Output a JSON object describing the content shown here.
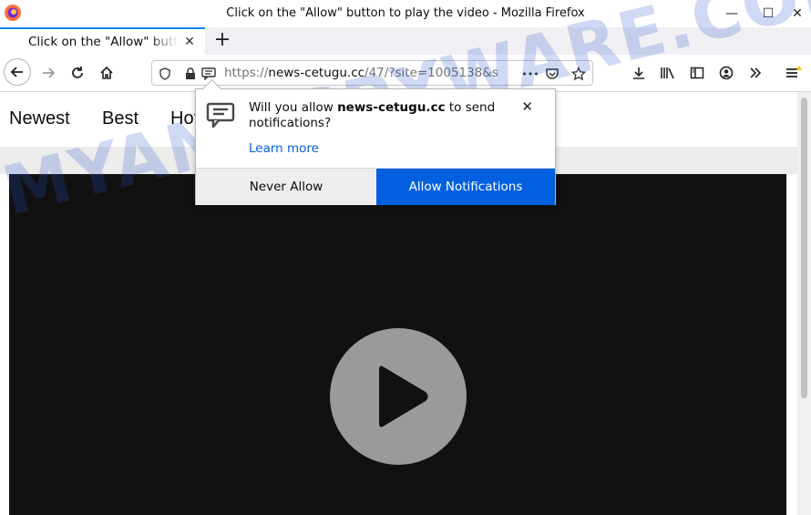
{
  "window": {
    "title": "Click on the \"Allow\" button to play the video - Mozilla Firefox",
    "minimize_glyph": "—",
    "maximize_glyph": "☐",
    "close_glyph": "✕"
  },
  "tab": {
    "label": "Click on the \"Allow\" button to play the video",
    "close_glyph": "✕",
    "new_tab_glyph": "+"
  },
  "urlbar": {
    "scheme": "https://",
    "host": "news-cetugu.cc",
    "path": "/47/?site=1005138&s",
    "more_glyph": "•••"
  },
  "site_nav": {
    "items": [
      "Newest",
      "Best",
      "Hot"
    ]
  },
  "popup": {
    "message_prefix": "Will you allow ",
    "site": "news-cetugu.cc",
    "message_suffix": " to send notifications?",
    "learn_more": "Learn more",
    "close_glyph": "✕",
    "never_allow": "Never Allow",
    "allow": "Allow Notifications"
  },
  "watermark": "MYANTISPYWARE.COM",
  "colors": {
    "accent": "#0060df",
    "tab_indicator": "#0a84ff",
    "video_bg": "#111111",
    "play_button": "#9a9a9a",
    "watermark": "#2850c8"
  },
  "icons": {
    "firefox": "firefox-logo-icon",
    "back": "back-arrow-icon",
    "forward": "forward-arrow-icon",
    "reload": "reload-icon",
    "home": "home-icon",
    "shield": "tracking-shield-icon",
    "lock": "lock-icon",
    "notification": "notification-icon",
    "pocket": "pocket-icon",
    "bookmark": "star-icon",
    "downloads": "download-icon",
    "library": "library-icon",
    "sidebar": "sidebar-icon",
    "account": "account-icon",
    "overflow": "chevron-double-right-icon",
    "menu": "hamburger-menu-icon",
    "play": "play-icon"
  }
}
